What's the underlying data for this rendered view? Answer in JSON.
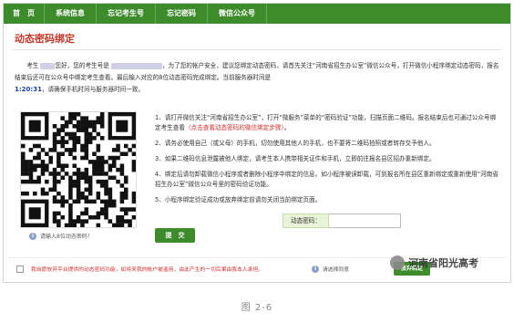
{
  "nav": {
    "items": [
      "首　页",
      "系统信息",
      "忘记考生号",
      "忘记密码",
      "微信公众号"
    ]
  },
  "page": {
    "title": "动态密码绑定"
  },
  "intro": {
    "p1_a": "考生",
    "p1_b": "您好，您的考生号是",
    "p1_c": "，为了您的帐户安全，建议您绑定动态密码，请首先关注“河南省招生办公室”微信公众",
    "p2": "号，打开微信小程序绑定动态密码，报名结束后还可在公众号中绑定考生查看。最后输入对应的8位动态密码完成绑定。当前服务器时间是",
    "time": "1:20:31",
    "p3": "，请确保手机时间与服务器时间一致。"
  },
  "qr": {
    "hint": "请输入8位动态密码！"
  },
  "steps": [
    {
      "num": "1、",
      "text": "请打开微信关注“河南省招生办公室”，打开“微服务”菜单的“密码验证”功能，扫描页面二维码。报名结束后也可通过公众号绑定考生查看",
      "red": "（点击查看动态密码的微信绑定步骤）",
      "after": "。"
    },
    {
      "num": "2、",
      "text": "请务必使用自己（或父母）的手机，切勿使用其他人的手机，也不要将二维码拍照或者转存交予他人。",
      "red": "",
      "after": ""
    },
    {
      "num": "3、",
      "text": "如果二维码信息泄露被他人绑定，请考生本人携带相关证件和手机，立即前往报名县区招办重新绑定。",
      "red": "",
      "after": ""
    },
    {
      "num": "4、",
      "text": "绑定后请勿卸载微信小程序或者删除小程序中绑定的信息。如小程序被误卸载，可到报名所在县区重新绑定或重新使用“河南省招生办公室”微信公众号里的密码验证功能。",
      "red": "",
      "after": ""
    },
    {
      "num": "5、",
      "text": "小程序绑定验证成功或放弃绑定前请勿关闭当前绑定页面。",
      "red": "",
      "after": ""
    }
  ],
  "form": {
    "code_label": "动态密码：",
    "code_value": "",
    "submit_label": "提　交"
  },
  "footer": {
    "checkbox_text": "我自愿放弃平台提供的动态密码功能，如将来我的帐户被盗用，由此产生的一切后果由我本人承担。",
    "hint": "请选择同意",
    "unbind_label": "放弃绑定"
  },
  "watermark": {
    "text": "河南省阳光高考"
  },
  "caption": "图 2-6",
  "colors": {
    "nav_bg": "#3d8b2a",
    "title_red": "#c0392b",
    "alert_red": "#d0312d",
    "time_blue": "#1a3fa0"
  }
}
